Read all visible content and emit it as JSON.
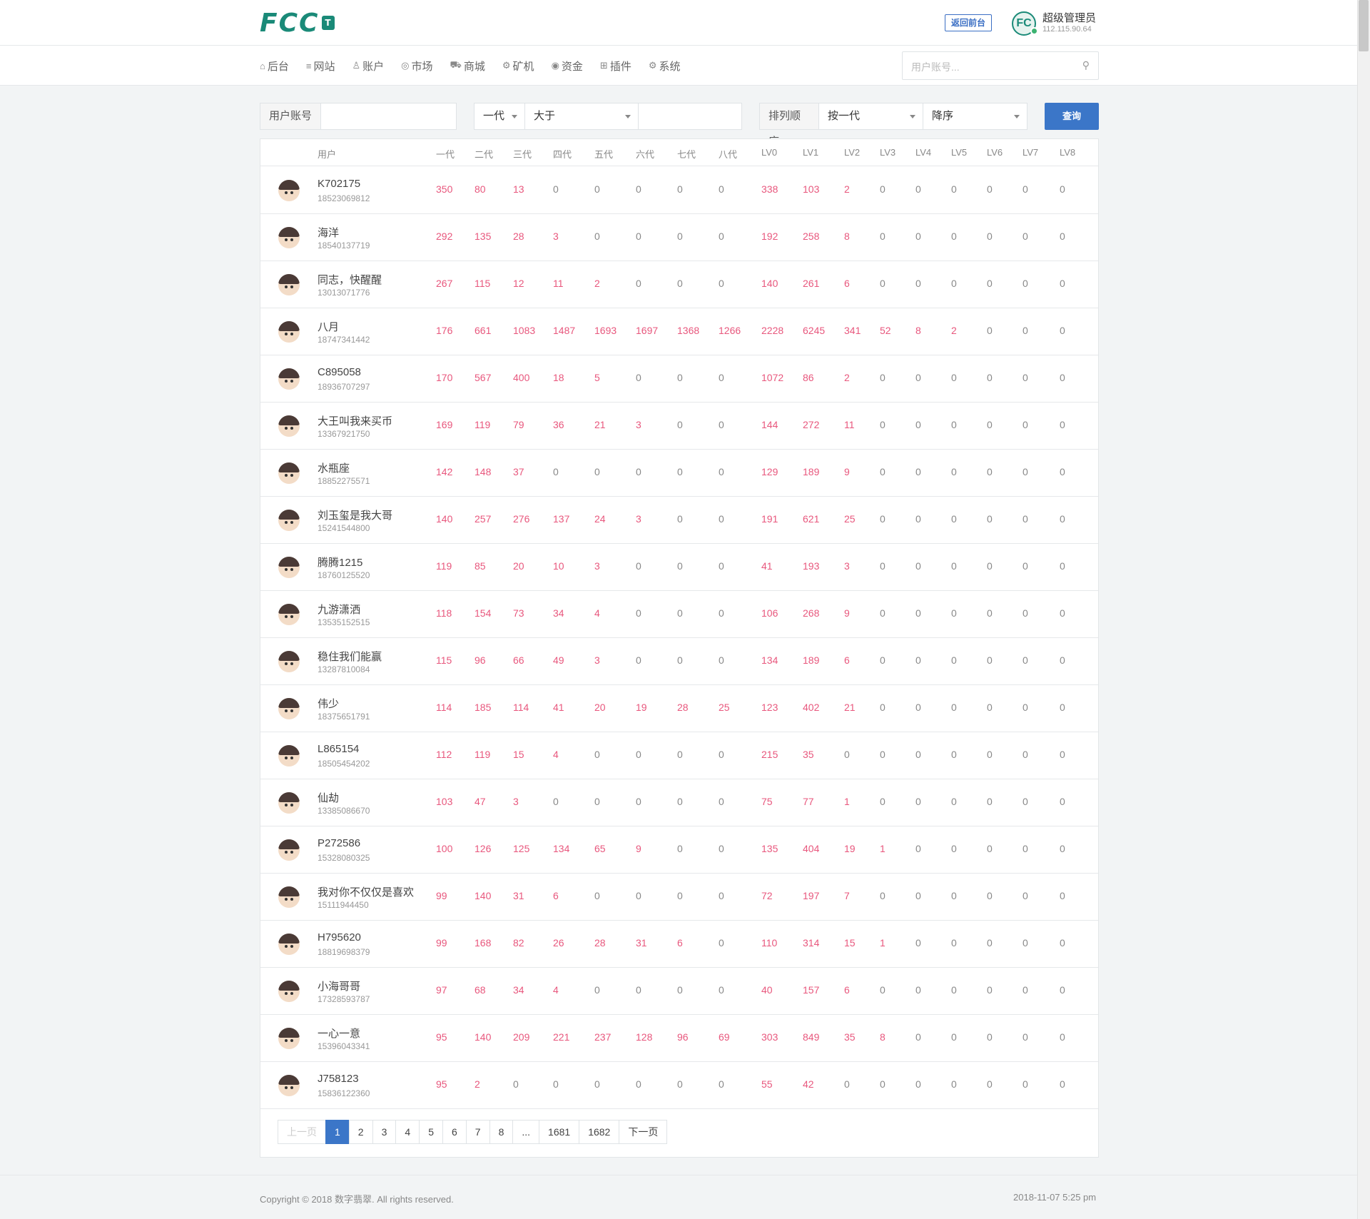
{
  "header": {
    "logo_text": "FCC",
    "logo_badge": "T",
    "front_button": "返回前台",
    "admin_avatar_text": "FC",
    "admin_name": "超级管理员",
    "admin_ip": "112.115.90.64"
  },
  "nav": {
    "items": [
      {
        "icon": "⌂",
        "label": "后台"
      },
      {
        "icon": "≡",
        "label": "网站"
      },
      {
        "icon": "♙",
        "label": "账户"
      },
      {
        "icon": "◎",
        "label": "市场"
      },
      {
        "icon": "⛟",
        "label": "商城"
      },
      {
        "icon": "⚙",
        "label": "矿机"
      },
      {
        "icon": "◉",
        "label": "资金"
      },
      {
        "icon": "⊞",
        "label": "插件"
      },
      {
        "icon": "⚙",
        "label": "系统"
      }
    ],
    "search_placeholder": "用户账号...",
    "search_icon": "⚲"
  },
  "filter": {
    "account_label": "用户账号",
    "account_value": "",
    "gen_select": "一代",
    "compare_select": "大于",
    "compare_value": "",
    "order_label": "排列顺序",
    "order_by_select": "按一代",
    "direction_select": "降序",
    "query_button": "查询"
  },
  "table": {
    "columns": [
      "用户",
      "一代",
      "二代",
      "三代",
      "四代",
      "五代",
      "六代",
      "七代",
      "八代",
      "LV0",
      "LV1",
      "LV2",
      "LV3",
      "LV4",
      "LV5",
      "LV6",
      "LV7",
      "LV8"
    ],
    "rows": [
      {
        "name": "K702175",
        "phone": "18523069812",
        "v": [
          350,
          80,
          13,
          0,
          0,
          0,
          0,
          0,
          338,
          103,
          2,
          0,
          0,
          0,
          0,
          0,
          0
        ]
      },
      {
        "name": "海洋",
        "phone": "18540137719",
        "v": [
          292,
          135,
          28,
          3,
          0,
          0,
          0,
          0,
          192,
          258,
          8,
          0,
          0,
          0,
          0,
          0,
          0
        ]
      },
      {
        "name": "同志，快醒醒",
        "phone": "13013071776",
        "v": [
          267,
          115,
          12,
          11,
          2,
          0,
          0,
          0,
          140,
          261,
          6,
          0,
          0,
          0,
          0,
          0,
          0
        ]
      },
      {
        "name": "八月",
        "phone": "18747341442",
        "v": [
          176,
          661,
          1083,
          1487,
          1693,
          1697,
          1368,
          1266,
          2228,
          6245,
          341,
          52,
          8,
          2,
          0,
          0,
          0
        ]
      },
      {
        "name": "C895058",
        "phone": "18936707297",
        "v": [
          170,
          567,
          400,
          18,
          5,
          0,
          0,
          0,
          1072,
          86,
          2,
          0,
          0,
          0,
          0,
          0,
          0
        ]
      },
      {
        "name": "大王叫我来买币",
        "phone": "13367921750",
        "v": [
          169,
          119,
          79,
          36,
          21,
          3,
          0,
          0,
          144,
          272,
          11,
          0,
          0,
          0,
          0,
          0,
          0
        ]
      },
      {
        "name": "水瓶座",
        "phone": "18852275571",
        "v": [
          142,
          148,
          37,
          0,
          0,
          0,
          0,
          0,
          129,
          189,
          9,
          0,
          0,
          0,
          0,
          0,
          0
        ]
      },
      {
        "name": "刘玉玺是我大哥",
        "phone": "15241544800",
        "v": [
          140,
          257,
          276,
          137,
          24,
          3,
          0,
          0,
          191,
          621,
          25,
          0,
          0,
          0,
          0,
          0,
          0
        ]
      },
      {
        "name": "腾腾1215",
        "phone": "18760125520",
        "v": [
          119,
          85,
          20,
          10,
          3,
          0,
          0,
          0,
          41,
          193,
          3,
          0,
          0,
          0,
          0,
          0,
          0
        ]
      },
      {
        "name": "九游潇洒",
        "phone": "13535152515",
        "v": [
          118,
          154,
          73,
          34,
          4,
          0,
          0,
          0,
          106,
          268,
          9,
          0,
          0,
          0,
          0,
          0,
          0
        ]
      },
      {
        "name": "稳住我们能赢",
        "phone": "13287810084",
        "v": [
          115,
          96,
          66,
          49,
          3,
          0,
          0,
          0,
          134,
          189,
          6,
          0,
          0,
          0,
          0,
          0,
          0
        ]
      },
      {
        "name": "伟少",
        "phone": "18375651791",
        "v": [
          114,
          185,
          114,
          41,
          20,
          19,
          28,
          25,
          123,
          402,
          21,
          0,
          0,
          0,
          0,
          0,
          0
        ]
      },
      {
        "name": "L865154",
        "phone": "18505454202",
        "v": [
          112,
          119,
          15,
          4,
          0,
          0,
          0,
          0,
          215,
          35,
          0,
          0,
          0,
          0,
          0,
          0,
          0
        ]
      },
      {
        "name": "仙劫",
        "phone": "13385086670",
        "v": [
          103,
          47,
          3,
          0,
          0,
          0,
          0,
          0,
          75,
          77,
          1,
          0,
          0,
          0,
          0,
          0,
          0
        ]
      },
      {
        "name": "P272586",
        "phone": "15328080325",
        "v": [
          100,
          126,
          125,
          134,
          65,
          9,
          0,
          0,
          135,
          404,
          19,
          1,
          0,
          0,
          0,
          0,
          0
        ]
      },
      {
        "name": "我对你不仅仅是喜欢",
        "phone": "15111944450",
        "v": [
          99,
          140,
          31,
          6,
          0,
          0,
          0,
          0,
          72,
          197,
          7,
          0,
          0,
          0,
          0,
          0,
          0
        ]
      },
      {
        "name": "H795620",
        "phone": "18819698379",
        "v": [
          99,
          168,
          82,
          26,
          28,
          31,
          6,
          0,
          110,
          314,
          15,
          1,
          0,
          0,
          0,
          0,
          0
        ]
      },
      {
        "name": "小海哥哥",
        "phone": "17328593787",
        "v": [
          97,
          68,
          34,
          4,
          0,
          0,
          0,
          0,
          40,
          157,
          6,
          0,
          0,
          0,
          0,
          0,
          0
        ]
      },
      {
        "name": "一心一意",
        "phone": "15396043341",
        "v": [
          95,
          140,
          209,
          221,
          237,
          128,
          96,
          69,
          303,
          849,
          35,
          8,
          0,
          0,
          0,
          0,
          0
        ]
      },
      {
        "name": "J758123",
        "phone": "15836122360",
        "v": [
          95,
          2,
          0,
          0,
          0,
          0,
          0,
          0,
          55,
          42,
          0,
          0,
          0,
          0,
          0,
          0,
          0
        ]
      }
    ]
  },
  "pagination": {
    "prev": "上一页",
    "pages": [
      "1",
      "2",
      "3",
      "4",
      "5",
      "6",
      "7",
      "8",
      "...",
      "1681",
      "1682"
    ],
    "active": "1",
    "next": "下一页"
  },
  "footer": {
    "copyright": "Copyright © 2018 数字翡翠. All rights reserved.",
    "datetime": "2018-11-07 5:25 pm"
  },
  "colors": {
    "accent": "#3b76c8",
    "highlight": "#e8577d",
    "brand": "#1a8a78"
  }
}
